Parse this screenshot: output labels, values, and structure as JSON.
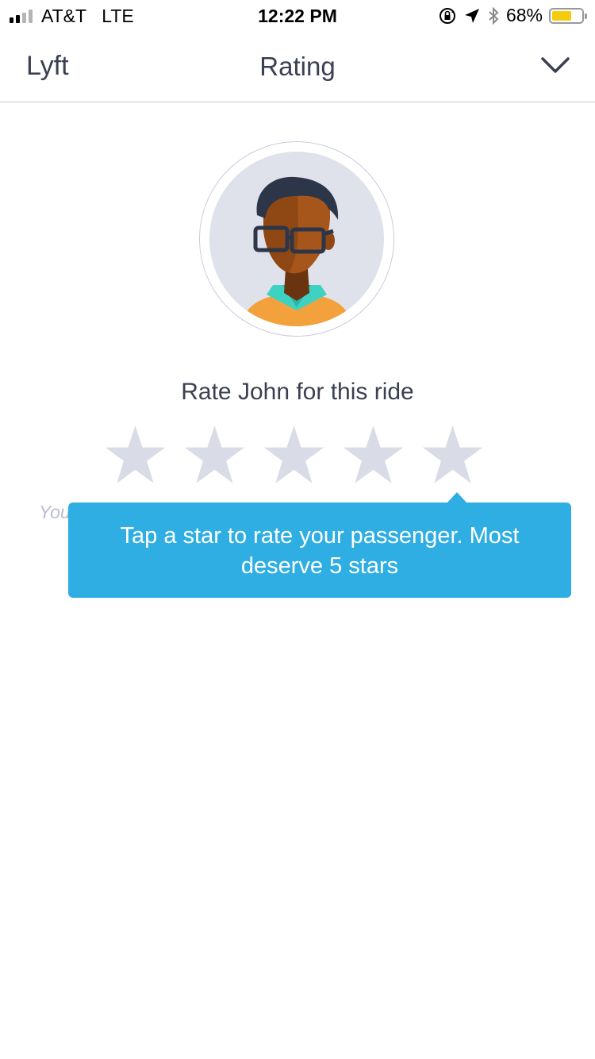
{
  "status_bar": {
    "carrier": "AT&T",
    "network": "LTE",
    "time": "12:22 PM",
    "battery_percent": "68%",
    "battery_level": 0.68,
    "signal_bars_filled": 2,
    "signal_bars_total": 4,
    "icons": [
      "orientation-lock-icon",
      "location-arrow-icon",
      "bluetooth-icon"
    ],
    "battery_color": "#f5cb0e"
  },
  "nav": {
    "left_label": "Lyft",
    "title": "Rating",
    "close_icon": "chevron-down-icon"
  },
  "rating": {
    "heading": "Rate John for this ride",
    "stars_total": 5,
    "stars_selected": 0,
    "star_color": "#d9dce6",
    "hint_partial": "You"
  },
  "tooltip": {
    "text": "Tap a star to rate your passenger. Most deserve 5 stars",
    "background": "#2eaee2"
  },
  "colors": {
    "text_primary": "#3b3f52",
    "divider": "#c8c8cc"
  }
}
